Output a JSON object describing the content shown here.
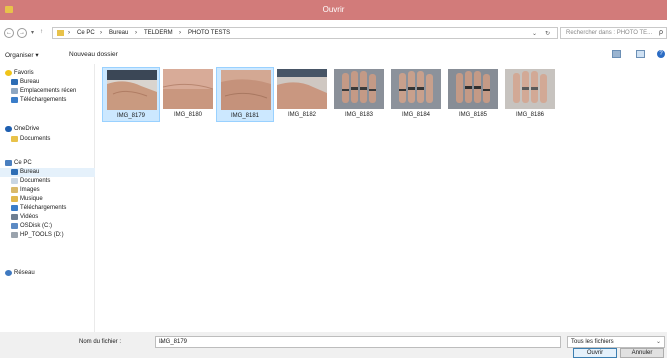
{
  "window": {
    "title": "Ouvrir"
  },
  "address": {
    "segments": [
      "Ce PC",
      "Bureau",
      "TELDERM",
      "PHOTO TESTS"
    ],
    "separator": "›",
    "nav_back": "←",
    "nav_forward": "→",
    "nav_recent": "▾",
    "nav_up": "↑",
    "dropdown": "⌄",
    "refresh": "↻"
  },
  "search": {
    "placeholder": "Rechercher dans : PHOTO TE...",
    "icon": "ρ"
  },
  "toolbar": {
    "organize": "Organiser ▾",
    "new_folder": "Nouveau dossier",
    "help": "?"
  },
  "nav": {
    "favorites_header": "Favoris",
    "favorites": [
      "Bureau",
      "Emplacements récen",
      "Téléchargements"
    ],
    "onedrive_header": "OneDrive",
    "onedrive": [
      "Documents"
    ],
    "pc_header": "Ce PC",
    "pc": [
      "Bureau",
      "Documents",
      "Images",
      "Musique",
      "Téléchargements",
      "Vidéos",
      "OSDisk (C:)",
      "HP_TOOLS (D:)"
    ],
    "network": "Réseau"
  },
  "files": [
    {
      "name": "IMG_8179",
      "kind": "hand-sleeve",
      "selected": true
    },
    {
      "name": "IMG_8180",
      "kind": "skin"
    },
    {
      "name": "IMG_8181",
      "kind": "skin",
      "selected": true
    },
    {
      "name": "IMG_8182",
      "kind": "hand"
    },
    {
      "name": "IMG_8183",
      "kind": "hand-rings"
    },
    {
      "name": "IMG_8184",
      "kind": "hand-rings"
    },
    {
      "name": "IMG_8185",
      "kind": "hand-rings"
    },
    {
      "name": "IMG_8186",
      "kind": "hand-rings-light"
    }
  ],
  "bottom": {
    "filename_label": "Nom du fichier :",
    "filename_value": "IMG_8179",
    "filter_value": "Tous les fichiers",
    "open_button": "Ouvrir",
    "cancel_button": "Annuler",
    "dropdown": "⌄"
  },
  "colors": {
    "titlebar": "#d27b7a",
    "selection": "#cce8ff",
    "accent": "#2b6cc4"
  }
}
